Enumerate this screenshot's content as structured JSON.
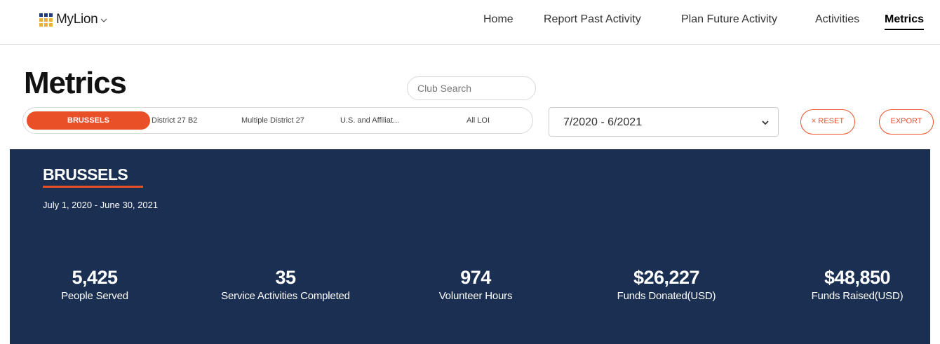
{
  "header": {
    "brand": "MyLion",
    "nav": [
      {
        "label": "Home"
      },
      {
        "label": "Report Past Activity"
      },
      {
        "label": "Plan Future Activity"
      },
      {
        "label": "Activities"
      },
      {
        "label": "Metrics",
        "active": true
      }
    ]
  },
  "page": {
    "title": "Metrics",
    "search_placeholder": "Club Search",
    "level_tabs": [
      {
        "label": "BRUSSELS",
        "active": true
      },
      {
        "label": "District 27 B2"
      },
      {
        "label": "Multiple District 27"
      },
      {
        "label": "U.S. and Affiliat..."
      },
      {
        "label": "All LOI"
      }
    ],
    "date_range_select": "7/2020 - 6/2021",
    "reset_label": "× RESET",
    "export_label": "EXPORT"
  },
  "panel": {
    "club_name": "BRUSSELS",
    "date_range": "July 1, 2020 - June 30, 2021",
    "metrics": [
      {
        "value": "5,425",
        "label": "People Served"
      },
      {
        "value": "35",
        "label": "Service Activities Completed"
      },
      {
        "value": "974",
        "label": "Volunteer Hours"
      },
      {
        "value": "$26,227",
        "label": "Funds Donated(USD)"
      },
      {
        "value": "$48,850",
        "label": "Funds Raised(USD)"
      }
    ]
  },
  "colors": {
    "accent": "#ea5027",
    "panel_bg": "#1a2f52",
    "brand_blue": "#1e3a78",
    "brand_gold": "#e8b33a"
  },
  "icons": {
    "brand_icon": "grid-icon",
    "brand_menu": "chevron-down-icon",
    "select_arrow": "chevron-down-icon"
  }
}
